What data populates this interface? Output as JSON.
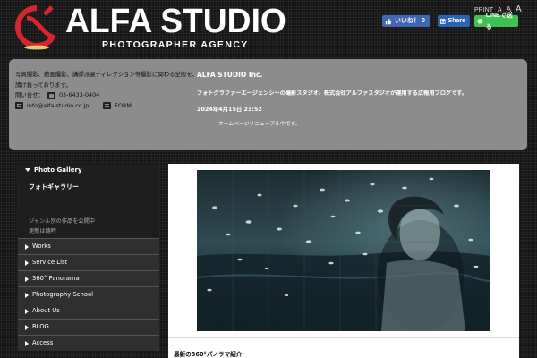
{
  "header": {
    "logo_title": "ALFA STUDIO",
    "logo_subtitle": "PHOTOGRAPHER AGENCY",
    "font_size": {
      "label": "PRINT",
      "small": "A",
      "medium": "A",
      "large": "A"
    },
    "share": {
      "facebook": "いいね！ 0",
      "linkedin": "Share",
      "line": "LINEで送る"
    }
  },
  "info": {
    "intro": "写真撮影、動画撮影、講師派遣ディレクション等撮影に関わる全般を、請け負っております。",
    "contact_label": "問い合せ：",
    "phone": "03-6433-0404",
    "email": "info@alfa-studio.co.jp",
    "form": "FORM",
    "company": "ALFA STUDIO Inc.",
    "description": "フォトグラファーエージェンシーの撮影スタジオ、株式会社アルファスタジオが運用する広報用ブログです。",
    "date": "2024年4月15日  23:52",
    "notice": "ホームページリニューアル中です。"
  },
  "sidebar": {
    "gallery_heading": "Photo Gallery",
    "gallery_subtitle": "フォトギャラリー",
    "gallery_desc_1": "ジャンル別の作品を公開中",
    "gallery_desc_2": "更新は随時",
    "items": [
      {
        "label": "Works"
      },
      {
        "label": "Service List"
      },
      {
        "label": "360° Panorama"
      },
      {
        "label": "Photography School"
      },
      {
        "label": "About Us"
      },
      {
        "label": "BLOG"
      },
      {
        "label": "Access"
      }
    ]
  },
  "main": {
    "bottom_label": "最新の360°パノラマ紹介"
  },
  "colors": {
    "logo_red": "#d4262e",
    "logo_gold": "#e8c777",
    "info_bg": "#8c8c8c",
    "facebook": "#4267b2",
    "linkedin": "#2b63b6",
    "line": "#3fc14f"
  }
}
